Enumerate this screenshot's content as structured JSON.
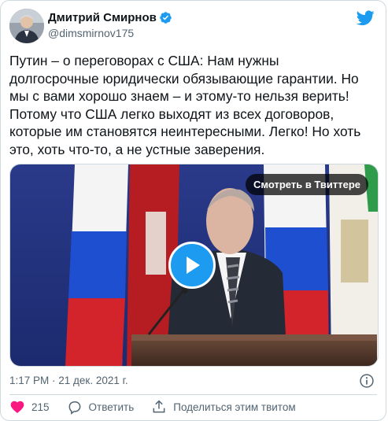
{
  "author": {
    "name": "Дмитрий Смирнов",
    "handle": "@dimsmirnov175"
  },
  "tweet": {
    "text": "Путин – о переговорах с США: Нам нужны\nдолгосрочные юридически обязывающие гарантии. Но\nмы с вами хорошо знаем – и этому-то нельзя верить!\nПотому что США легко выходят из всех договоров,\nкоторые им становятся неинтересными. Легко! Но хоть\nэто, хоть что-то, а не устные заверения.",
    "timestamp": "1:17 PM · 21 дек. 2021 г."
  },
  "media": {
    "watch_label": "Смотреть в Твиттере"
  },
  "actions": {
    "like_count": "215",
    "reply_label": "Ответить",
    "share_label": "Поделиться этим твитом"
  },
  "colors": {
    "accent": "#1d9bf0",
    "like": "#f91880",
    "secondary_text": "#536471"
  },
  "icons": [
    "verified-badge-icon",
    "twitter-logo-icon",
    "play-icon",
    "info-icon",
    "heart-icon",
    "reply-icon",
    "share-icon"
  ]
}
